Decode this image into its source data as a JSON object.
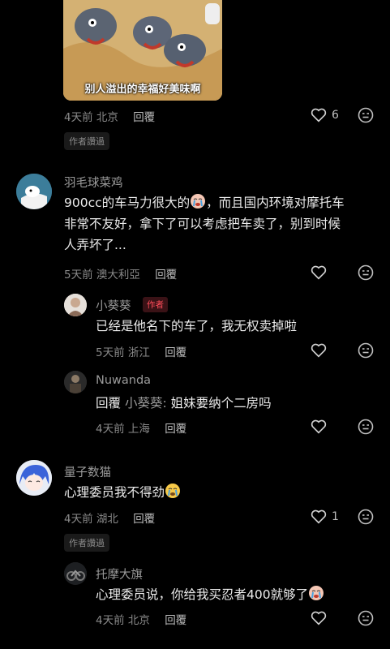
{
  "comments": [
    {
      "image_caption": "别人溢出的幸福好美味啊",
      "time": "4天前",
      "location": "北京",
      "reply_label": "回覆",
      "likes": "6",
      "author_liked": "作者讚過"
    },
    {
      "name": "羽毛球菜鸡",
      "text_line1": "900cc的车马力很大的",
      "text_line1b": "，而且国内环境对摩托车",
      "text_line2": "非常不友好，拿下了可以考虑把车卖了，别到时候",
      "text_line3": "人弄坏了...",
      "time": "5天前",
      "location": "澳大利亞",
      "reply_label": "回覆",
      "replies": [
        {
          "name": "小葵葵",
          "badge": "作者",
          "text": "已经是他名下的车了，我无权卖掉啦",
          "time": "5天前",
          "location": "浙江",
          "reply_label": "回覆"
        },
        {
          "name": "Nuwanda",
          "reply_prefix": "回覆",
          "reply_to": "小葵葵:",
          "text": "姐妹要纳个二房吗",
          "time": "4天前",
          "location": "上海",
          "reply_label": "回覆"
        }
      ]
    },
    {
      "name": "量子数猫",
      "text": "心理委员我不得劲",
      "time": "4天前",
      "location": "湖北",
      "reply_label": "回覆",
      "likes": "1",
      "author_liked": "作者讚過",
      "replies": [
        {
          "name": "托摩大旗",
          "text": "心理委员说，你给我买忍者400就够了",
          "time": "4天前",
          "location": "北京",
          "reply_label": "回覆"
        }
      ]
    }
  ],
  "icons": [
    "heart-icon",
    "emoji-reaction-icon",
    "crying-emoji-icon"
  ]
}
